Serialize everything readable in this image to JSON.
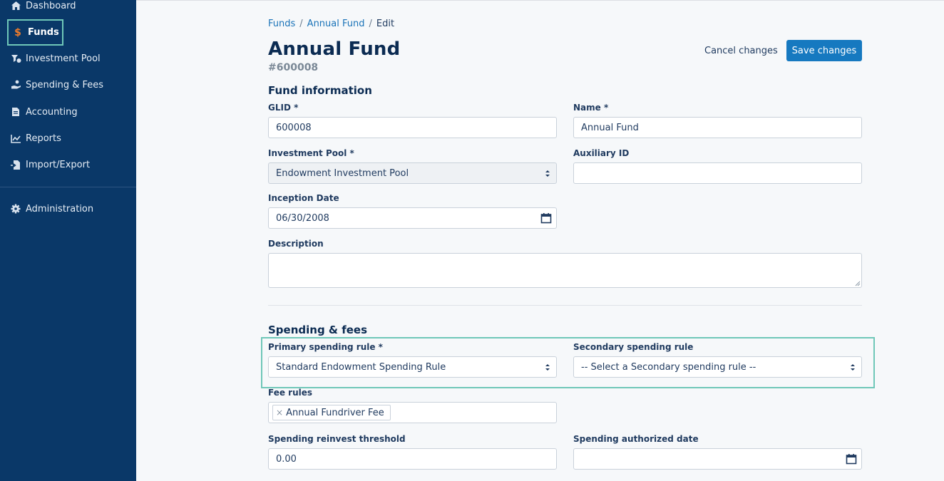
{
  "sidebar": {
    "items": [
      {
        "label": "Dashboard",
        "icon": "home-icon"
      },
      {
        "label": "Funds",
        "icon": "dollar-icon"
      },
      {
        "label": "Investment Pool",
        "icon": "pool-icon"
      },
      {
        "label": "Spending & Fees",
        "icon": "hand-coin-icon"
      },
      {
        "label": "Accounting",
        "icon": "ledger-icon"
      },
      {
        "label": "Reports",
        "icon": "chart-line-icon"
      },
      {
        "label": "Import/Export",
        "icon": "file-import-icon"
      },
      {
        "label": "Administration",
        "icon": "gear-icon"
      }
    ]
  },
  "breadcrumb": {
    "funds": "Funds",
    "sep": "/",
    "fund": "Annual Fund",
    "current": "Edit"
  },
  "header": {
    "title": "Annual Fund",
    "subtitle": "#600008",
    "cancel_label": "Cancel changes",
    "save_label": "Save changes"
  },
  "fund_info": {
    "heading": "Fund information",
    "glid_label": "GLID *",
    "glid_value": "600008",
    "name_label": "Name *",
    "name_value": "Annual Fund",
    "pool_label": "Investment Pool *",
    "pool_value": "Endowment Investment Pool",
    "aux_label": "Auxiliary ID",
    "aux_value": "",
    "inception_label": "Inception Date",
    "inception_value": "06/30/2008",
    "description_label": "Description",
    "description_value": ""
  },
  "spending": {
    "heading": "Spending & fees",
    "primary_label": "Primary spending rule *",
    "primary_value": "Standard Endowment Spending Rule",
    "secondary_label": "Secondary spending rule",
    "secondary_value": "-- Select a Secondary spending rule --",
    "fee_label": "Fee rules",
    "fee_tag": "Annual Fundriver Fee",
    "fee_remove": "×",
    "threshold_label": "Spending reinvest threshold",
    "threshold_value": "0.00",
    "authorized_label": "Spending authorized date",
    "authorized_value": ""
  },
  "colors": {
    "sidebar_bg": "#0a3868",
    "highlight": "#6fc7b8",
    "primary_button": "#1679c0",
    "funds_icon": "#f07c2a"
  }
}
